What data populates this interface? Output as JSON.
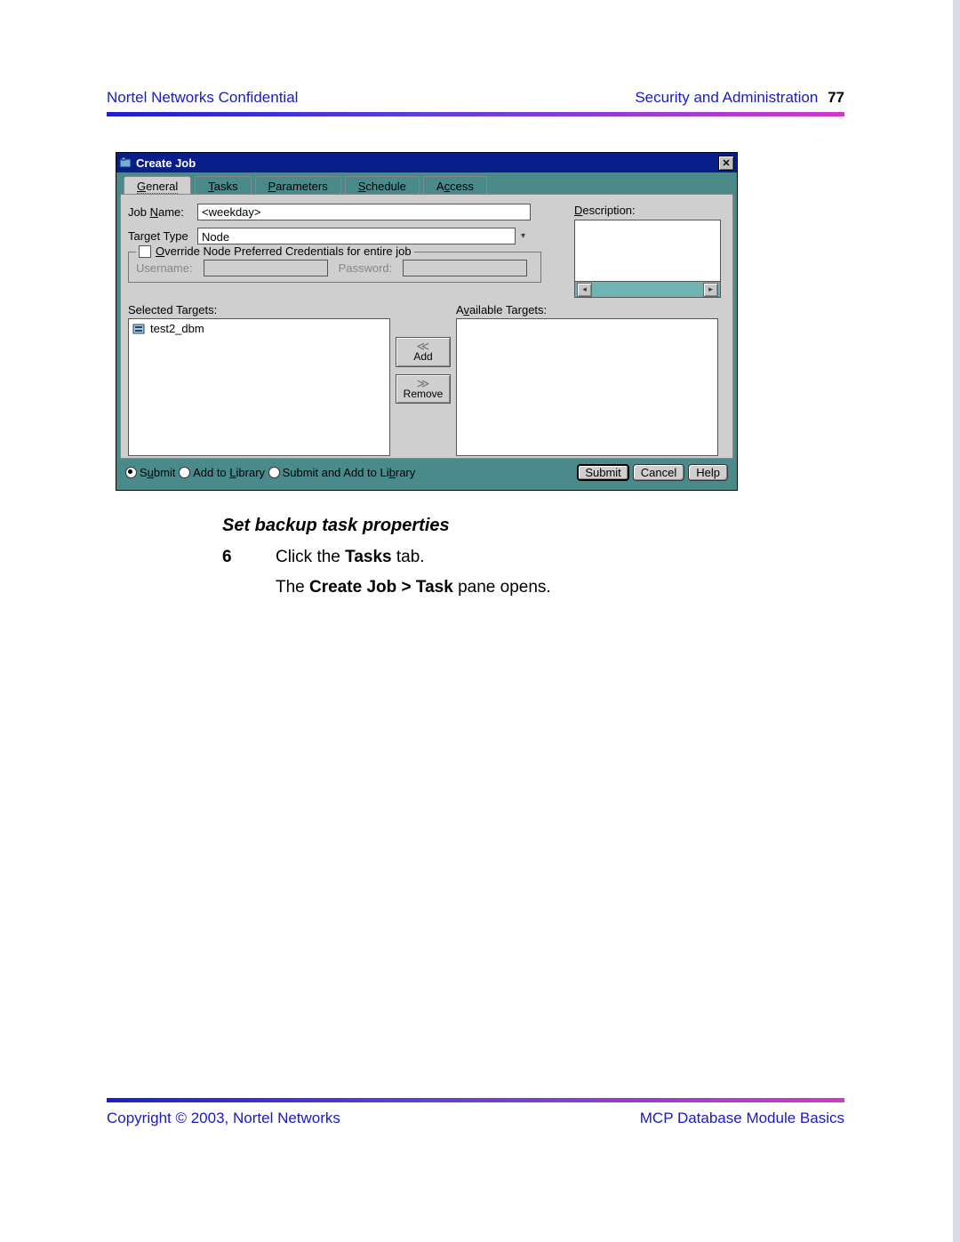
{
  "header": {
    "left": "Nortel Networks Confidential",
    "right_text": "Security and Administration",
    "page_num": "77"
  },
  "window": {
    "title": "Create Job",
    "tabs": {
      "general": "General",
      "tasks": "Tasks",
      "parameters": "Parameters",
      "schedule": "Schedule",
      "access": "Access"
    },
    "labels": {
      "job_name": "Job Name:",
      "target_type": "Target Type",
      "description": "Description:",
      "override": "Override Node Preferred Credentials for entire job",
      "username": "Username:",
      "password": "Password:",
      "selected_targets": "Selected Targets:",
      "available_targets": "Available Targets:",
      "add": "Add",
      "remove": "Remove"
    },
    "values": {
      "job_name": "<weekday>",
      "target_type": "Node"
    },
    "selected_targets": [
      "test2_dbm"
    ],
    "radios": {
      "submit": "Submit",
      "addlib": "Add to Library",
      "both": "Submit and Add to Library"
    },
    "buttons": {
      "submit": "Submit",
      "cancel": "Cancel",
      "help": "Help"
    }
  },
  "doc": {
    "subhead": "Set backup task properties",
    "step_num": "6",
    "step_line1_a": "Click the ",
    "step_line1_b": "Tasks",
    "step_line1_c": " tab.",
    "step_line2_a": "The ",
    "step_line2_b": "Create Job > Task",
    "step_line2_c": " pane opens."
  },
  "footer": {
    "left": "Copyright © 2003, Nortel Networks",
    "right": "MCP Database Module Basics"
  }
}
